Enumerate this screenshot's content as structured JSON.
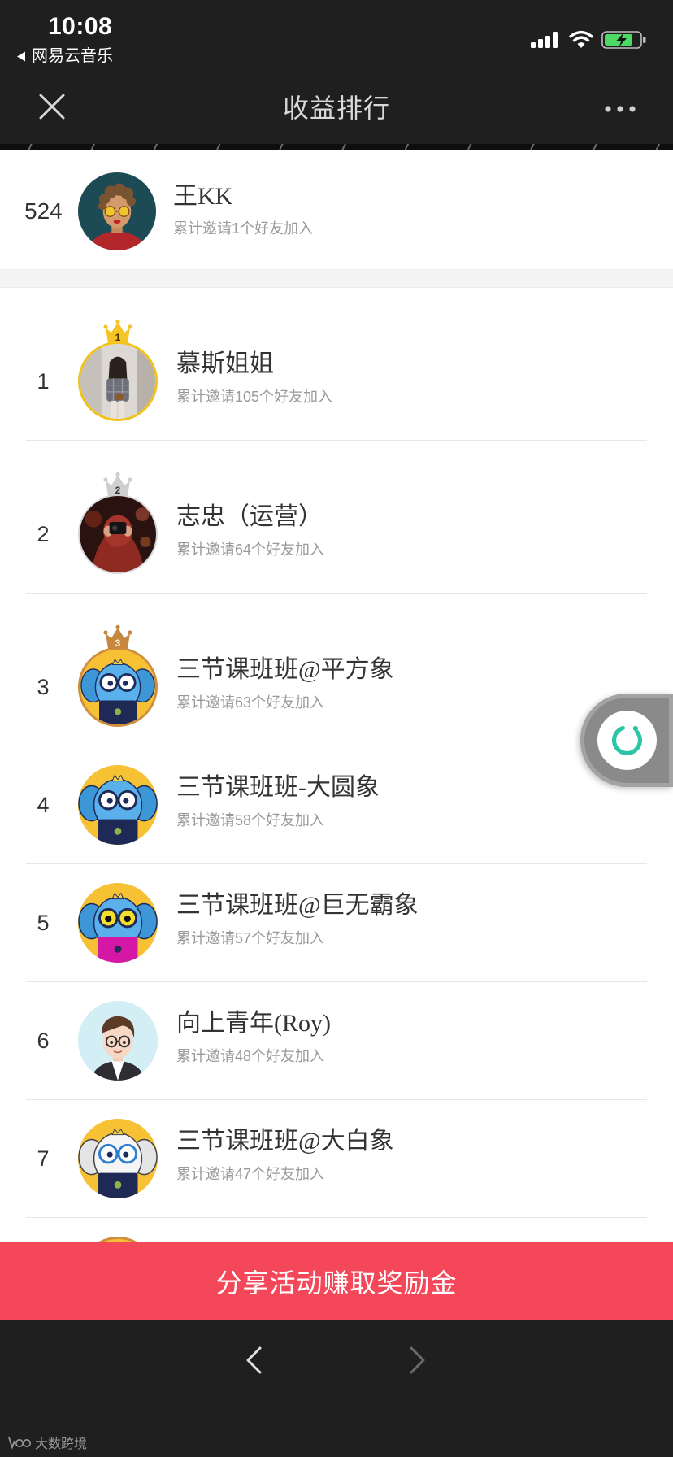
{
  "status": {
    "time": "10:08",
    "back_app": "网易云音乐"
  },
  "nav": {
    "title": "收益排行"
  },
  "my_rank": {
    "rank": "524",
    "name": "王KK",
    "desc": "累计邀请1个好友加入"
  },
  "leaderboard": [
    {
      "rank": "1",
      "name": "慕斯姐姐",
      "desc": "累计邀请105个好友加入",
      "crown": "gold-crown-icon"
    },
    {
      "rank": "2",
      "name": "志忠（运营）",
      "desc": "累计邀请64个好友加入",
      "crown": "silver-crown-icon"
    },
    {
      "rank": "3",
      "name": "三节课班班@平方象",
      "desc": "累计邀请63个好友加入",
      "crown": "bronze-crown-icon"
    },
    {
      "rank": "4",
      "name": "三节课班班-大圆象",
      "desc": "累计邀请58个好友加入"
    },
    {
      "rank": "5",
      "name": "三节课班班@巨无霸象",
      "desc": "累计邀请57个好友加入"
    },
    {
      "rank": "6",
      "name": "向上青年(Roy)",
      "desc": "累计邀请48个好友加入"
    },
    {
      "rank": "7",
      "name": "三节课班班@大白象",
      "desc": "累计邀请47个好友加入"
    }
  ],
  "share_button": {
    "label": "分享活动赚取奖励金"
  },
  "watermark": {
    "text": "大数跨境"
  },
  "icons": {
    "status": [
      "back-triangle-icon",
      "cellular-signal-icon",
      "wifi-icon",
      "battery-icon"
    ],
    "nav": [
      "close-icon",
      "more-options-icon"
    ],
    "floating": "refresh-icon",
    "bottom": [
      "back-chevron-icon",
      "forward-chevron-icon"
    ]
  },
  "theme": {
    "accent": "#f4475a",
    "bar_bg": "#1f1f1f",
    "crown_gold": "#f5c523",
    "crown_silver": "#cfcfcf",
    "crown_bronze": "#c5883e",
    "ring_gold": "#f2c21c",
    "ring_bronze": "#cf8f3c",
    "refresh_teal": "#2ec4a6",
    "battery_green": "#4cd964"
  }
}
